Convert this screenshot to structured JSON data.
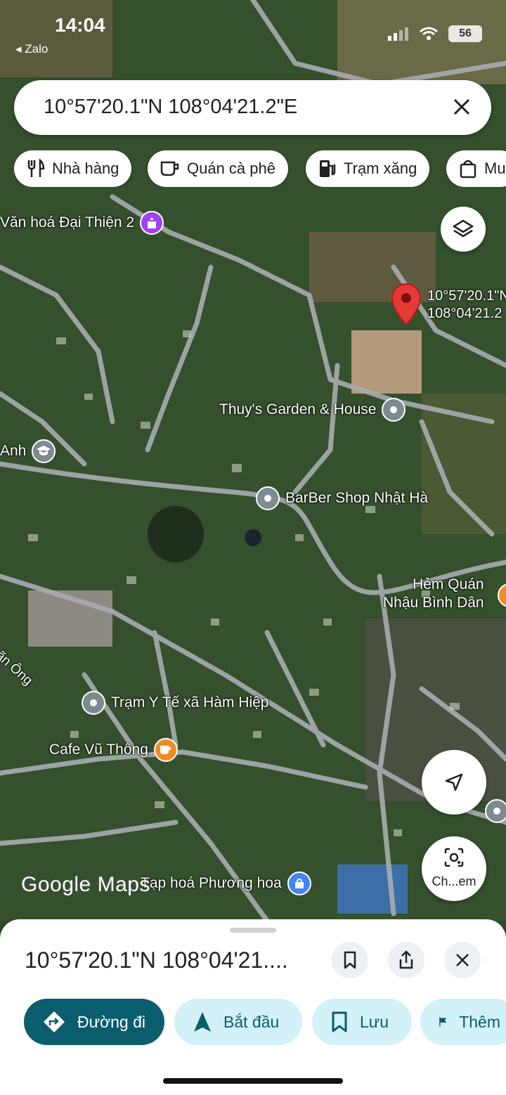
{
  "status_bar": {
    "time": "14:04",
    "back_app": "◂ Zalo",
    "battery": "56"
  },
  "search": {
    "query": "10°57'20.1\"N 108°04'21.2\"E"
  },
  "chips": [
    {
      "label": "Nhà hàng",
      "icon": "utensils-icon"
    },
    {
      "label": "Quán cà phê",
      "icon": "coffee-icon"
    },
    {
      "label": "Trạm xăng",
      "icon": "gas-station-icon"
    },
    {
      "label": "Mu",
      "icon": "shopping-bag-icon"
    }
  ],
  "pin": {
    "line1": "10°57'20.1\"N",
    "line2": "108°04'21.2",
    "color": "#e53935"
  },
  "pois": {
    "temple": "Văn hoá Đại Thiện 2",
    "school": "Anh",
    "garden": "Thuy's Garden & House",
    "barber": "BarBer Shop Nhật Hà",
    "restaurant_line1": "Hẻm Quán",
    "restaurant_line2": "Nhậu Bình Dân",
    "street": "Lãn Ông",
    "clinic": "Trạm Y Tế xã Hàm Hiệp",
    "cafe": "Cafe Vũ Thông",
    "store": "Tạp hoá Phương hoa"
  },
  "map": {
    "attribution": "Google Maps",
    "lens_label": "Ch...em"
  },
  "sheet": {
    "title": "10°57'20.1\"N 108°04'21....",
    "actions": {
      "directions": "Đường đi",
      "start": "Bắt đầu",
      "save": "Lưu",
      "more": "Thêm"
    }
  },
  "colors": {
    "accent": "#0b5d6e",
    "chip_bg": "#d3f1f8",
    "cafe_icon": "#f28b25",
    "temple_icon": "#a142f4",
    "poi_gray": "#7d8a90"
  }
}
